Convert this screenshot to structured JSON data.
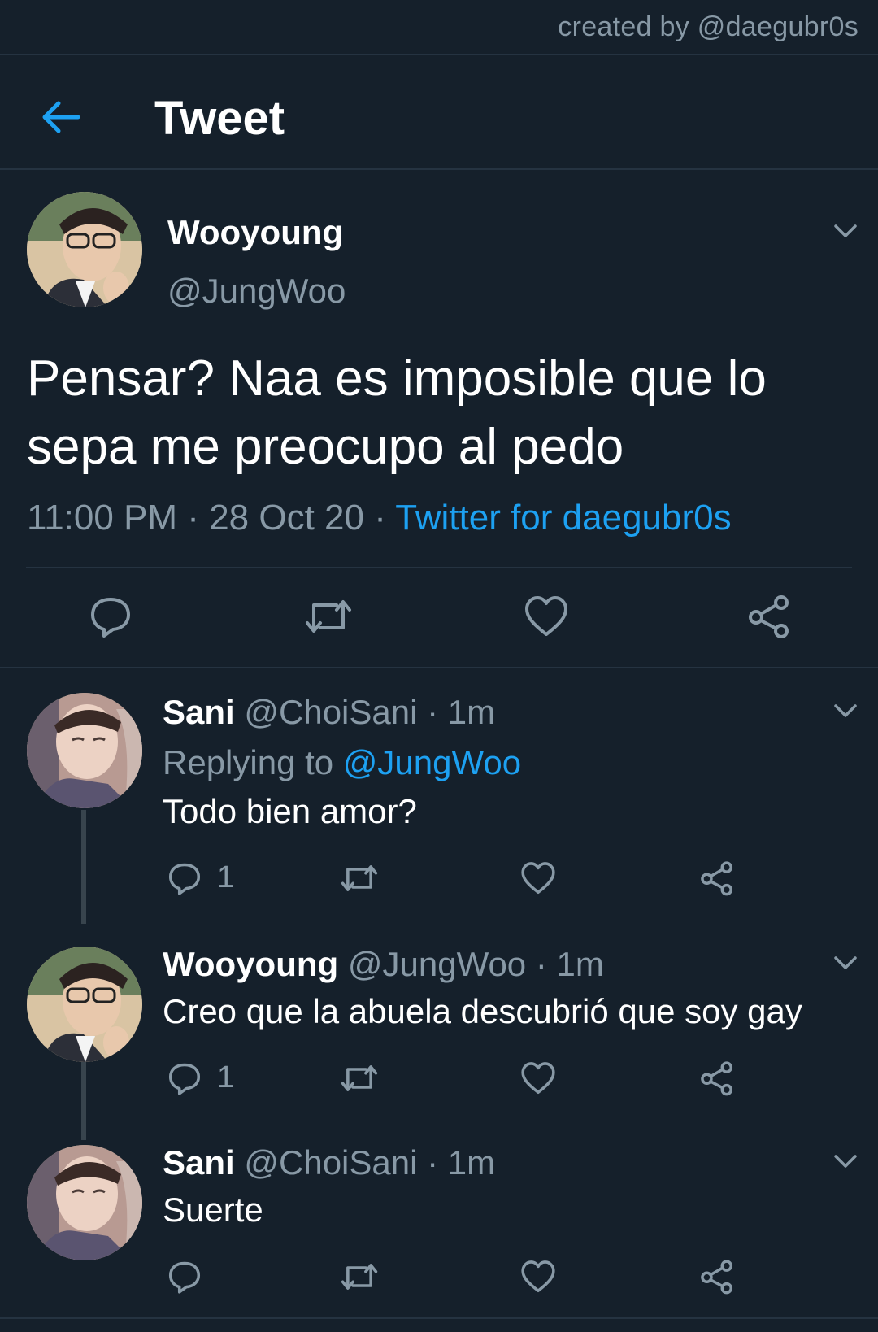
{
  "credit": "created by @daegubr0s",
  "header": {
    "title": "Tweet",
    "back_icon": "arrow-left-icon",
    "accent": "#1da1f2"
  },
  "main_tweet": {
    "name": "Wooyoung",
    "handle": "@JungWoo",
    "text": "Pensar? Naa es imposible que lo sepa me preocupo al pedo",
    "time": "11:00 PM",
    "date": "28 Oct 20",
    "source": "Twitter for daegubr0s"
  },
  "replies": [
    {
      "name": "Sani",
      "handle": "@ChoiSani",
      "time": "1m",
      "replying_label": "Replying to",
      "replying_to": "@JungWoo",
      "text": "Todo bien amor?",
      "reply_count": "1"
    },
    {
      "name": "Wooyoung",
      "handle": "@JungWoo",
      "time": "1m",
      "text": "Creo que la abuela descubrió que soy gay",
      "reply_count": "1"
    },
    {
      "name": "Sani",
      "handle": "@ChoiSani",
      "time": "1m",
      "text": "Suerte",
      "reply_count": ""
    }
  ],
  "colors": {
    "background": "#15202b",
    "muted": "#8899a6",
    "accent": "#1da1f2",
    "divider": "#253341"
  }
}
